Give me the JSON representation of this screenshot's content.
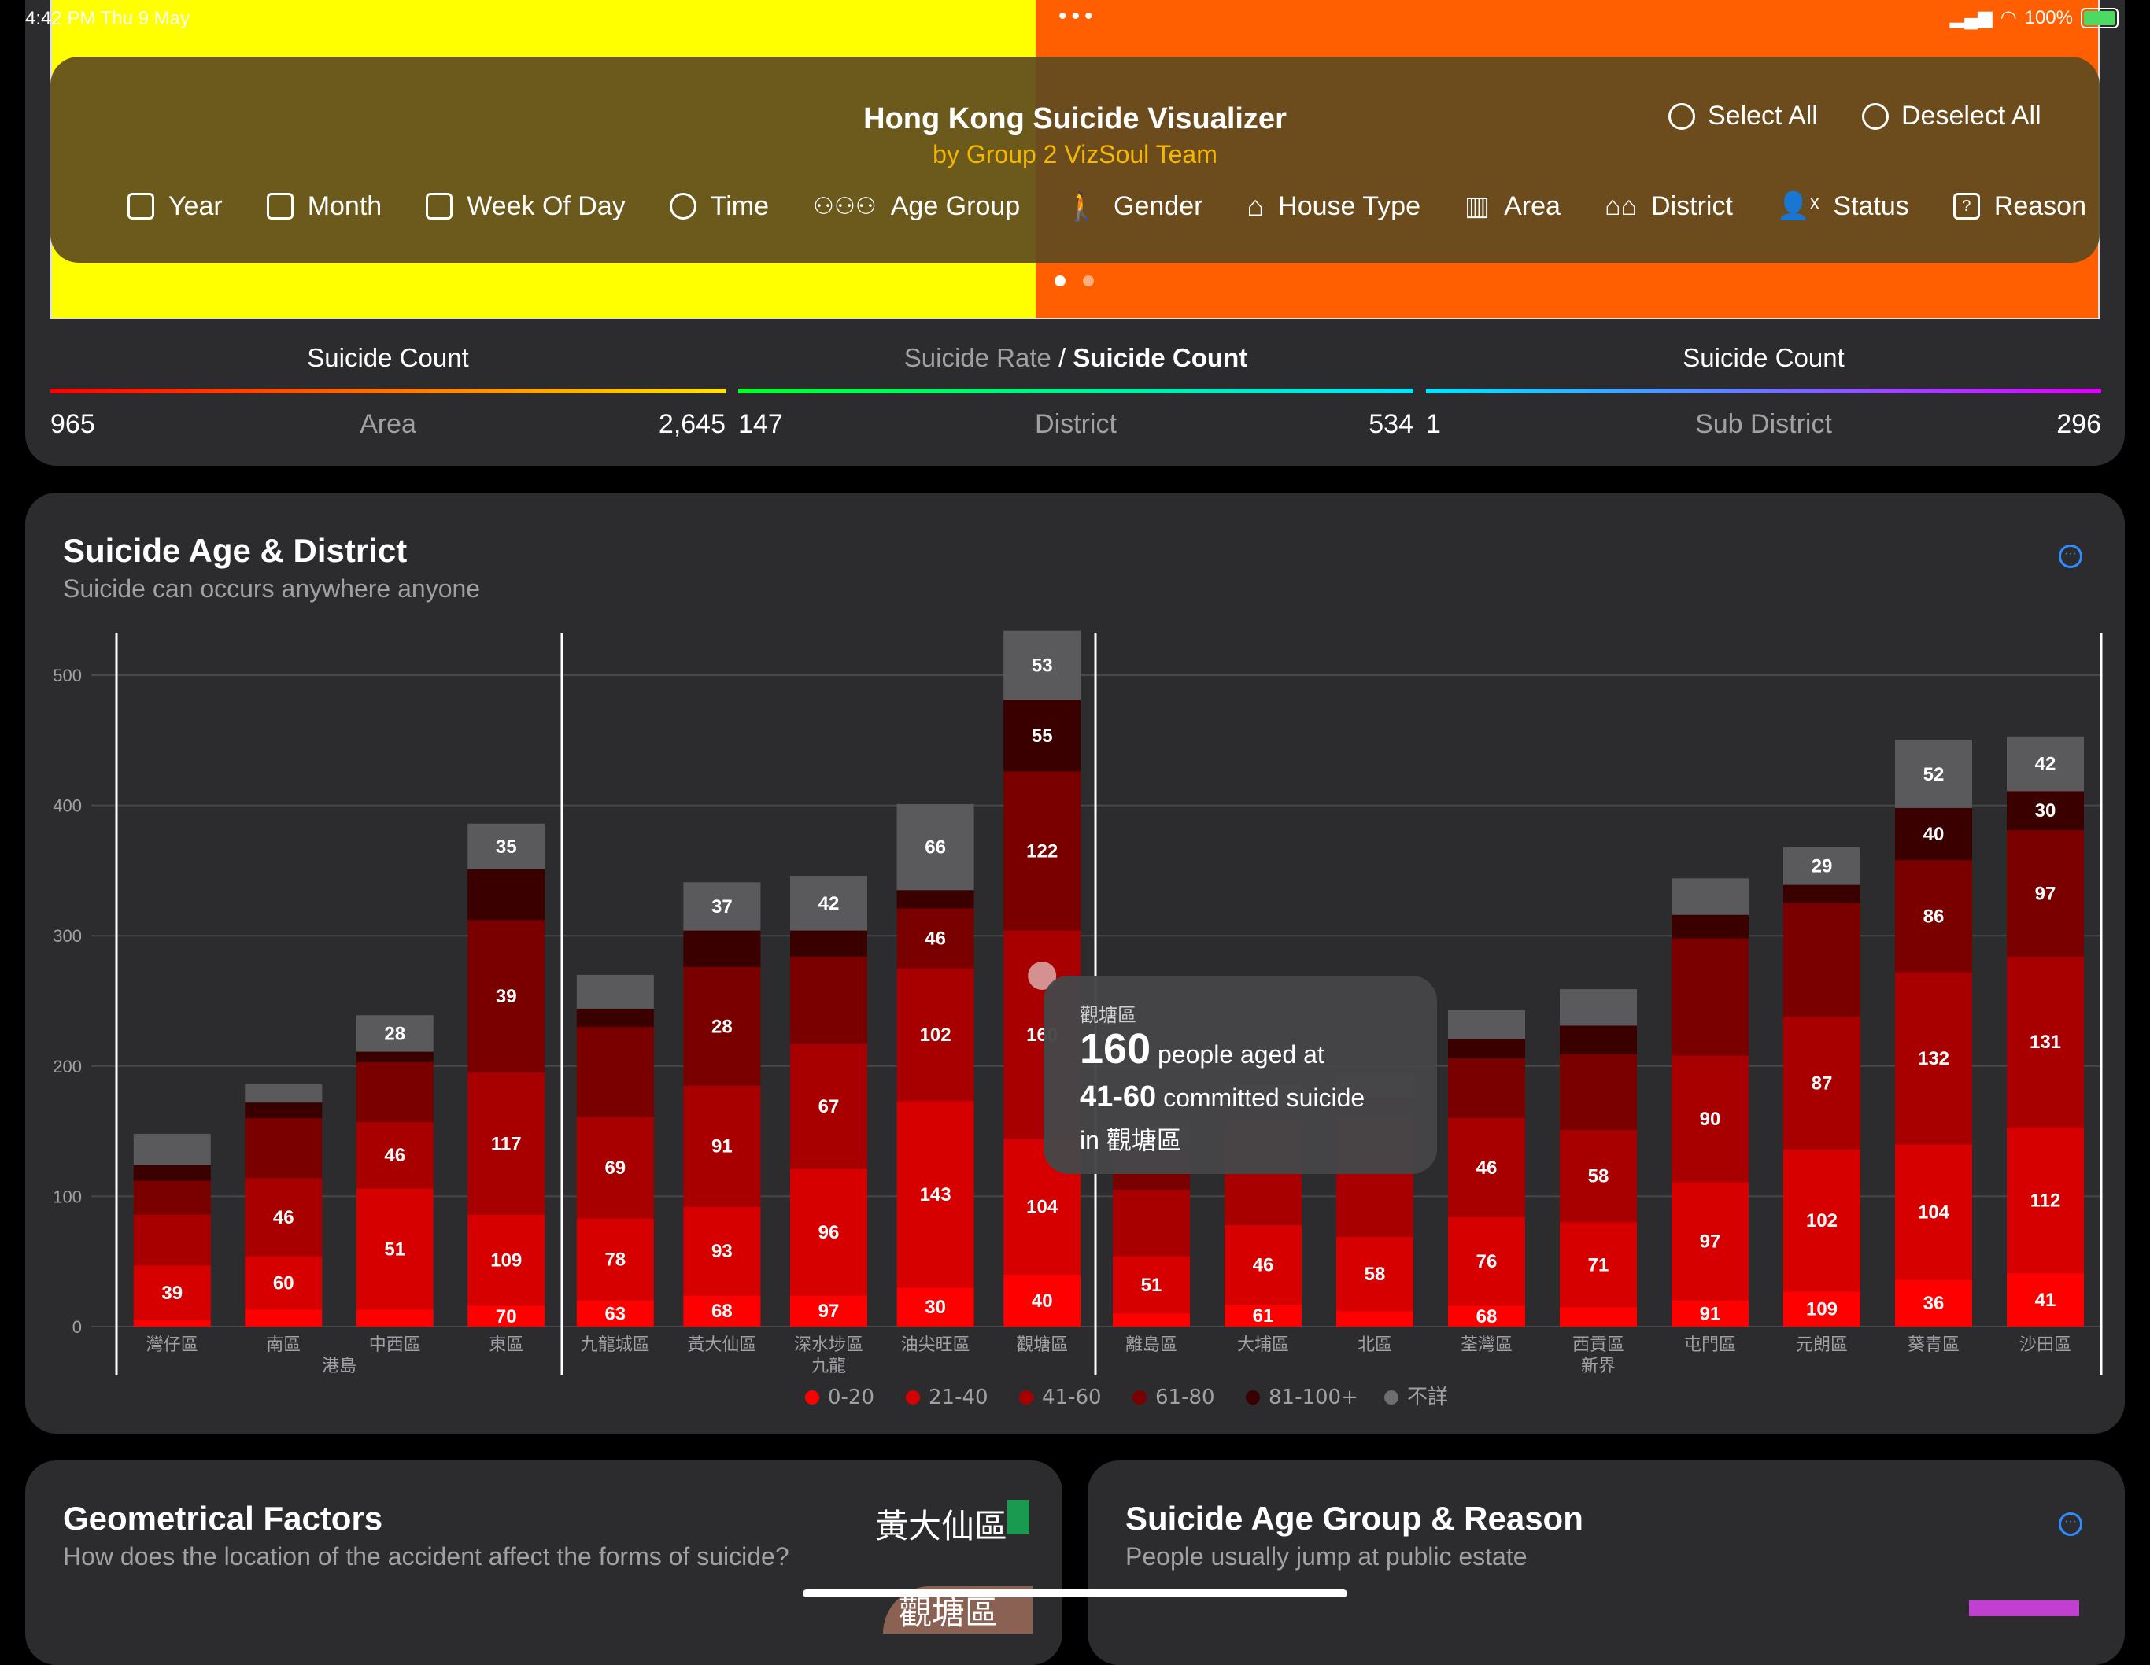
{
  "status_bar": {
    "time": "4:42 PM  Thu 9 May",
    "battery": "100%"
  },
  "header": {
    "title": "Hong Kong Suicide Visualizer",
    "subtitle": "by Group 2 VizSoul Team",
    "select_all": "Select All",
    "deselect_all": "Deselect All",
    "filters": [
      {
        "label": "Year",
        "icon": "calendar-icon"
      },
      {
        "label": "Month",
        "icon": "calendar-clock-icon"
      },
      {
        "label": "Week Of Day",
        "icon": "week-icon"
      },
      {
        "label": "Time",
        "icon": "clock-icon"
      },
      {
        "label": "Age Group",
        "icon": "people-icon"
      },
      {
        "label": "Gender",
        "icon": "person-icon"
      },
      {
        "label": "House Type",
        "icon": "house-icon"
      },
      {
        "label": "Area",
        "icon": "map-icon"
      },
      {
        "label": "District",
        "icon": "houses-icon"
      },
      {
        "label": "Status",
        "icon": "person-x-icon"
      },
      {
        "label": "Reason",
        "icon": "question-icon"
      }
    ]
  },
  "legends": {
    "area": {
      "title": "Suicide Count",
      "label": "Area",
      "min": "965",
      "max": "2,645"
    },
    "district": {
      "title_pre": "Suicide Rate",
      "title_sep": " / ",
      "title": "Suicide Count",
      "label": "District",
      "min": "147",
      "max": "534"
    },
    "subdistrict": {
      "title": "Suicide Count",
      "label": "Sub District",
      "min": "1",
      "max": "296"
    }
  },
  "chart_card": {
    "title": "Suicide Age & District",
    "subtitle": "Suicide can occurs anywhere anyone"
  },
  "tooltip": {
    "district": "觀塘區",
    "count": "160",
    "text1": " people aged at",
    "age": "41-60",
    "text2": " committed suicide",
    "text3": "in 觀塘區"
  },
  "chart_data": {
    "type": "bar",
    "stacked": true,
    "ylim": [
      0,
      500
    ],
    "yticks": [
      0,
      100,
      200,
      300,
      400,
      500
    ],
    "groups": [
      {
        "name": "港島",
        "categories": [
          "灣仔區",
          "南區",
          "中西區",
          "東區"
        ]
      },
      {
        "name": "九龍",
        "categories": [
          "九龍城區",
          "黃大仙區",
          "深水埗區",
          "油尖旺區",
          "觀塘區"
        ]
      },
      {
        "name": "新界",
        "categories": [
          "離島區",
          "大埔區",
          "北區",
          "荃灣區",
          "西貢區",
          "屯門區",
          "元朗區",
          "葵青區",
          "沙田區"
        ]
      }
    ],
    "categories": [
      "灣仔區",
      "南區",
      "中西區",
      "東區",
      "九龍城區",
      "黃大仙區",
      "深水埗區",
      "油尖旺區",
      "觀塘區",
      "離島區",
      "大埔區",
      "北區",
      "荃灣區",
      "西貢區",
      "屯門區",
      "元朗區",
      "葵青區",
      "沙田區"
    ],
    "series": [
      {
        "name": "0-20",
        "color": "#ff0000",
        "values": [
          5,
          13,
          13,
          16,
          20,
          24,
          24,
          30,
          40,
          10,
          17,
          12,
          16,
          15,
          20,
          27,
          36,
          41
        ]
      },
      {
        "name": "21-40",
        "color": "#d60000",
        "values": [
          42,
          41,
          93,
          70,
          63,
          68,
          97,
          143,
          104,
          44,
          61,
          57,
          68,
          65,
          91,
          109,
          104,
          112
        ]
      },
      {
        "name": "41-60",
        "color": "#a80000",
        "values": [
          39,
          60,
          51,
          109,
          78,
          93,
          96,
          102,
          160,
          51,
          46,
          58,
          76,
          71,
          97,
          102,
          132,
          131
        ]
      },
      {
        "name": "61-80",
        "color": "#7a0000",
        "values": [
          26,
          46,
          46,
          117,
          69,
          91,
          67,
          46,
          122,
          25,
          30,
          35,
          46,
          58,
          90,
          87,
          86,
          97
        ]
      },
      {
        "name": "81-100+",
        "color": "#3a0000",
        "values": [
          12,
          12,
          8,
          39,
          14,
          28,
          20,
          14,
          55,
          10,
          14,
          14,
          15,
          22,
          18,
          14,
          40,
          30
        ]
      },
      {
        "name": "不詳",
        "color": "#5a5a5c",
        "values": [
          24,
          14,
          28,
          35,
          26,
          37,
          42,
          66,
          53,
          14,
          18,
          18,
          22,
          28,
          28,
          29,
          52,
          42
        ]
      }
    ],
    "labels_shown": [
      [
        42,
        39,
        null,
        null,
        null,
        null
      ],
      [
        41,
        60,
        46,
        null,
        null,
        null
      ],
      [
        93,
        51,
        46,
        null,
        null,
        28
      ],
      [
        70,
        109,
        117,
        39,
        null,
        35
      ],
      [
        63,
        78,
        69,
        null,
        null,
        null
      ],
      [
        68,
        93,
        91,
        28,
        null,
        37
      ],
      [
        97,
        96,
        67,
        null,
        null,
        42
      ],
      [
        30,
        143,
        102,
        46,
        null,
        66
      ],
      [
        40,
        104,
        160,
        122,
        55,
        53
      ],
      [
        44,
        51,
        null,
        null,
        null,
        null
      ],
      [
        61,
        46,
        null,
        null,
        null,
        null
      ],
      [
        57,
        58,
        null,
        null,
        null,
        null
      ],
      [
        68,
        76,
        46,
        null,
        null,
        null
      ],
      [
        65,
        71,
        58,
        null,
        null,
        null
      ],
      [
        91,
        97,
        90,
        null,
        null,
        null
      ],
      [
        109,
        102,
        87,
        null,
        null,
        29
      ],
      [
        36,
        104,
        132,
        86,
        40,
        52
      ],
      [
        41,
        112,
        131,
        97,
        30,
        42
      ]
    ]
  },
  "geo_card": {
    "title": "Geometrical Factors",
    "subtitle": "How does the location of the accident affect the forms of suicide?",
    "label1": "黃大仙區",
    "label2": "觀塘區"
  },
  "reason_card": {
    "title": "Suicide Age Group & Reason",
    "subtitle": "People usually jump at public estate"
  }
}
